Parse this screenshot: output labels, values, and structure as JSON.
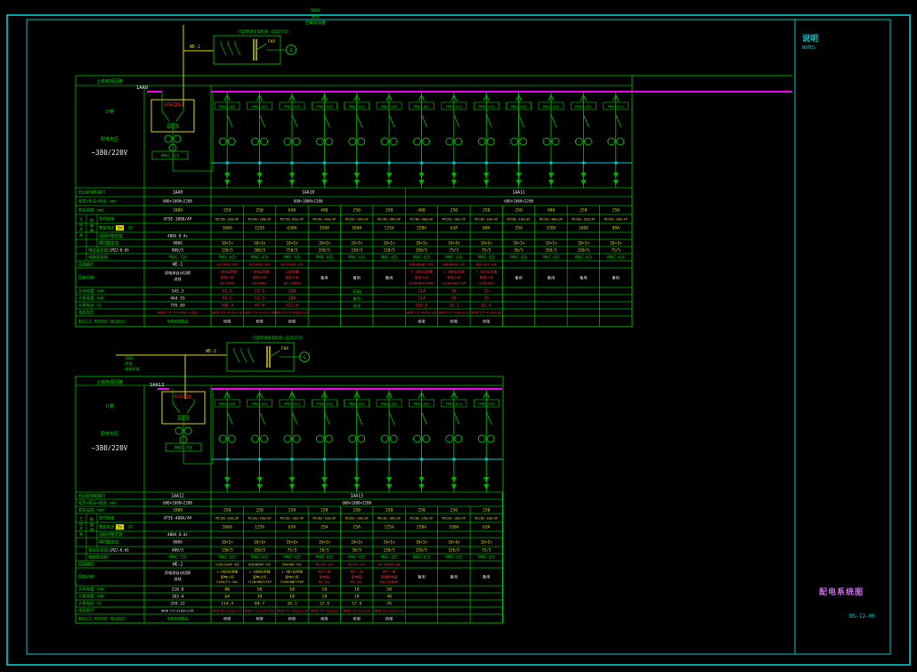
{
  "sheet": {
    "frame_color": "#00c8c8",
    "line_green": "#00b300",
    "text_green": "#00d000",
    "bus_magenta": "#f000f0",
    "yellow": "#d9d900",
    "red": "#ff3333",
    "white": "#ebebeb",
    "cyan": "#00c8c8",
    "title_magenta": "#cf6cf2",
    "notes": {
      "title": "说明",
      "subtitle": "NOTES"
    },
    "title_block": {
      "drawing_title": "配电系统图",
      "drawing_no": "DS-12-06"
    },
    "top_note": [
      "380V",
      "进线",
      "密集母线槽"
    ]
  },
  "table_labels": {
    "rows": [
      "低压配电柜编号",
      "柜宽×柜深×柜高（mm）",
      "安装高度（mm）",
      "型号规格",
      "整定电流",
      "短延时整定值",
      "瞬时整定值",
      "电流互感器",
      "电度表规格",
      "回路编号",
      "回路名称",
      "负荷容量（kW）",
      "计算容量（kW）",
      "计算电流（A）",
      "线缆型号",
      "敷设方式 电缆桥架（敷设部位）"
    ],
    "setting_hl": "In",
    "setting_post": "（A）",
    "ct_suffix": "LMZJ-0.66",
    "group_outer": "主进开关",
    "group_inner": "断路器"
  },
  "units": [
    {
      "header": "上级电源回路",
      "meter_room_label": "计量",
      "voltage_label": "配电电压",
      "voltage": "~380/220V",
      "bus_label": "1AA9",
      "incoming_id": "WE-1",
      "gen_note": "引自柴油发电机组（自动启动）",
      "gen_switch_label": "FKP",
      "gen_symbol": "G",
      "atse_red": "ATSE自投",
      "atse_green": "双电源",
      "sections": [
        {
          "name": "1AA9",
          "dims": "800×1000×2200",
          "span": 0
        },
        {
          "name": "1AA10",
          "dims": "600×1000×2200",
          "span": 6
        },
        {
          "name": "1AA11",
          "dims": "600×1000×2200",
          "span": 7
        }
      ],
      "incoming": {
        "height": "1800",
        "model": "ATSE-1000/4P",
        "delay": "400A 0.4s",
        "inst": "800A",
        "ct": "800/5",
        "meter": "PMAC-725",
        "id": "WE-1",
        "name": [
          "双电源自动切换",
          "进线"
        ],
        "load": "545.3",
        "calc": "464.55",
        "amps": "795.69",
        "cable": "WDZN-YJY-2(4×240+1×120)",
        "cablec": "r",
        "lay": "电缆桥架敷设"
      },
      "spare_note": [
        "380V",
        "备用",
        "出线"
      ],
      "feeders": [
        {
          "height": "250",
          "model": "MCCBS-160/3P",
          "setting": "160A",
          "inst": "10×In",
          "ct": "150/5",
          "meter": "PMAC-625",
          "id": "BV/1APE2-4ZE",
          "idc": "r",
          "name": [
            "一层A区商铺",
            "配电小间",
            "1N/1APE2"
          ],
          "nc": "r",
          "load": "55.5",
          "calc": "55.5",
          "amps": "105.4",
          "numc": "r",
          "cable": "WDZN-YJY-4×35+1×16",
          "lay": "桥架"
        },
        {
          "height": "250",
          "model": "MCCBS-160/3P",
          "setting": "125A",
          "inst": "10×In",
          "ct": "100/5",
          "meter": "PMAC-625",
          "id": "BV/2APE2-4ZE",
          "idc": "r",
          "name": [
            "一层B区商铺",
            "配电小间",
            "1N/2APE2"
          ],
          "nc": "r",
          "load": "51.5",
          "calc": "51.5",
          "amps": "97.8",
          "numc": "r",
          "cable": "WDZN-YJY-4×35+1×16",
          "lay": "桥架"
        },
        {
          "height": "630",
          "model": "MCCBS-630/3P",
          "setting": "630A",
          "inst": "10×In",
          "ct": "750/5",
          "meter": "PMAC-625",
          "id": "BV/1XHAPE-4ZE",
          "idc": "r",
          "name": [
            "二层商铺",
            "配电小间",
            "1N/1XHAPE"
          ],
          "nc": "r",
          "load": "280",
          "calc": "280",
          "amps": "531.8",
          "numc": "r",
          "cable": "WDZN-YJY-2(4×150+1×70)",
          "lay": "桥架"
        },
        {
          "height": "400",
          "model": "MCCBS-400/3P",
          "setting": "320A",
          "inst": "10×In",
          "ct": "350/5",
          "meter": "PMAC-625",
          "id": "",
          "name": [
            "备用"
          ],
          "nc": "w",
          "load": "",
          "calc": "",
          "amps": "",
          "numc": "w",
          "cable": "",
          "lay": ""
        },
        {
          "height": "250",
          "model": "MCCBS-160/3P",
          "setting": "160A",
          "inst": "10×In",
          "ct": "150/5",
          "meter": "PMAC-625",
          "id": "",
          "name": [
            "备用"
          ],
          "nc": "w",
          "load": "",
          "calc": "",
          "amps": "",
          "numc": "w",
          "cable": "",
          "lay": ""
        },
        {
          "height": "250",
          "model": "MCCBS-160/3P",
          "setting": "125A",
          "inst": "10×In",
          "ct": "150/5",
          "meter": "PMAC-625",
          "id": "",
          "name": [
            "备用"
          ],
          "nc": "w",
          "load": "",
          "calc": "",
          "amps": "",
          "numc": "w",
          "cable": "",
          "lay": ""
        },
        {
          "height": "400",
          "model": "MCCBS-400/3P",
          "setting": "320A",
          "inst": "10×In",
          "ct": "350/5",
          "meter": "PMAC-625",
          "id": "N2N/WDFWE2-4ZE",
          "idc": "r",
          "name": [
            "1-2层A区商铺",
            "配电小间",
            "S12W/WDFXTAP2"
          ],
          "nc": "r",
          "load": "114",
          "calc": "114",
          "amps": "216.5",
          "numc": "r",
          "cable": "WDZN-YJY-4×95+1×50",
          "lay": "桥架"
        },
        {
          "height": "250",
          "model": "MCCBS-100/3P",
          "setting": "63A",
          "inst": "10×In",
          "ct": "75/5",
          "meter": "PMAC-625",
          "id": "N2N/WDFWE-4ZE",
          "idc": "r",
          "name": [
            "1-2层B区商铺",
            "配电小间",
            "S12W/WDFXTAP"
          ],
          "nc": "r",
          "load": "18",
          "calc": "18",
          "amps": "39.1",
          "numc": "r",
          "cable": "WDZN-YJY-4×10+1×10",
          "lay": "桥架"
        },
        {
          "height": "250",
          "model": "MCCBS-100/3P",
          "setting": "80A",
          "inst": "10×In",
          "ct": "75/5",
          "meter": "PMAC-625",
          "id": "N2N/1ALE-4ZE",
          "idc": "r",
          "name": [
            "1-2层C区商铺",
            "配电小间",
            "S12W/1AL2"
          ],
          "nc": "r",
          "load": "35",
          "calc": "35",
          "amps": "62.6",
          "numc": "r",
          "cable": "WDZN-YJY-4×16+1×16",
          "lay": "桥架"
        },
        {
          "height": "250",
          "model": "MCCBS-100/3P",
          "setting": "25A",
          "inst": "10×In",
          "ct": "50/5",
          "meter": "PMAC-625",
          "id": "",
          "name": [
            "备用"
          ],
          "nc": "w",
          "load": "",
          "calc": "",
          "amps": "",
          "numc": "w",
          "cable": "",
          "lay": ""
        },
        {
          "height": "400",
          "model": "MCCBS-400/3P",
          "setting": "320A",
          "inst": "10×In",
          "ct": "350/5",
          "meter": "PMAC-625",
          "id": "",
          "name": [
            "备用"
          ],
          "nc": "w",
          "load": "",
          "calc": "",
          "amps": "",
          "numc": "w",
          "cable": "",
          "lay": ""
        },
        {
          "height": "250",
          "model": "MCCBS-160/3P",
          "setting": "160A",
          "inst": "10×In",
          "ct": "150/5",
          "meter": "PMAC-625",
          "id": "",
          "name": [
            "备用"
          ],
          "nc": "w",
          "load": "",
          "calc": "",
          "amps": "",
          "numc": "w",
          "cable": "",
          "lay": ""
        },
        {
          "height": "250",
          "model": "MCCBS-100/3P",
          "setting": "80A",
          "inst": "10×In",
          "ct": "75/5",
          "meter": "PMAC-625",
          "id": "",
          "name": [
            "备用"
          ],
          "nc": "w",
          "load": "",
          "calc": "",
          "amps": "",
          "numc": "w",
          "cable": "",
          "lay": ""
        }
      ]
    },
    {
      "header": "上级电源回路",
      "meter_room_label": "计量",
      "voltage_label": "配电电压",
      "voltage": "~380/220V",
      "bus_label": "1AA12",
      "incoming_id": "WE-2",
      "gen_note": "引自柴油发电机组（自动启动）",
      "gen_switch_label": "FKP",
      "gen_symbol": "G",
      "atse_red": "ATSE自投",
      "atse_green": "双电源",
      "incoming_note": [
        "380V",
        "进线",
        "电缆桥架"
      ],
      "sections": [
        {
          "name": "1AA12",
          "dims": "600×1000×2200",
          "span": 0
        },
        {
          "name": "1AA13",
          "dims": "600×1000×2200",
          "span": 9
        }
      ],
      "incoming": {
        "height": "1800",
        "model": "ATSE-400A/4P",
        "delay": "400A 0.4s",
        "inst": "800A",
        "ct": "400/5",
        "meter": "PMAC-725",
        "id": "WE-2",
        "name": [
          "双电源自动切换",
          "进线"
        ],
        "load": "218.8",
        "calc": "183.4",
        "amps": "259.22",
        "cable": "WDZN-YJY-4×185+1×95",
        "cablec": "w",
        "lay": "电缆桥架敷设"
      },
      "feeders": [
        {
          "height": "250",
          "model": "MCCBS-160/3P",
          "setting": "160A",
          "inst": "10×In",
          "ct": "150/5",
          "meter": "PMAC-625",
          "id": "S12W/1SHAP-4ZE",
          "idc": "y",
          "name": [
            "1-2层A区商铺",
            "配电小间",
            "S12W/F1-5AL"
          ],
          "nc": "y",
          "load": "80",
          "calc": "64",
          "amps": "114.4",
          "numc": "y",
          "cable": "WDZN-YJY-4×50+1×25",
          "lay": "桥架"
        },
        {
          "height": "250",
          "model": "MCCBS-160/3P",
          "setting": "125A",
          "inst": "10×In",
          "ct": "150/5",
          "meter": "PMAC-625",
          "id": "N2W/WDFWF-4ZE",
          "idc": "y",
          "name": [
            "1-2层B区商铺",
            "配电小间",
            "S12W/WDFXTAP"
          ],
          "nc": "y",
          "load": "50",
          "calc": "39",
          "amps": "84.7",
          "numc": "y",
          "cable": "WDZN-YJY-4×25+1×16",
          "lay": "桥架"
        },
        {
          "height": "250",
          "model": "MCCBS-100/3P",
          "setting": "63A",
          "inst": "10×In",
          "ct": "75/5",
          "meter": "PMAC-625",
          "id": "N2W/WDF-4ZE",
          "idc": "y",
          "name": [
            "1-2层C区商铺",
            "配电小间",
            "S12W/WDFXTAP"
          ],
          "nc": "y",
          "load": "18",
          "calc": "18",
          "amps": "39.1",
          "numc": "y",
          "cable": "WDZN-YJY-4×10+1×10",
          "lay": "桥架"
        },
        {
          "height": "250",
          "model": "MCCBS-100/3P",
          "setting": "25A",
          "inst": "10×In",
          "ct": "50/5",
          "meter": "PMAC-625",
          "id": "BV/4AL-4ZE",
          "idc": "r",
          "name": [
            "地下一层",
            "配电箱",
            "BV/4AL"
          ],
          "nc": "r",
          "load": "10",
          "calc": "10",
          "amps": "17.9",
          "numc": "y",
          "cable": "WDZN-YJY-4×6+1×6",
          "lay": "桥架"
        },
        {
          "height": "250",
          "model": "MCCBS-100/3P",
          "setting": "25A",
          "inst": "10×In",
          "ct": "50/5",
          "meter": "PMAC-625",
          "id": "BV/2AL-4ZE",
          "idc": "r",
          "name": [
            "地下一层",
            "配电箱",
            "BV/2AL"
          ],
          "nc": "r",
          "load": "10",
          "calc": "10",
          "amps": "17.9",
          "numc": "y",
          "cable": "WDZN-YJY-4×6+1×6",
          "lay": "桥架"
        },
        {
          "height": "250",
          "model": "MCCBS-160/3P",
          "setting": "125A",
          "inst": "10×In",
          "ct": "150/5",
          "meter": "PMAC-625",
          "id": "BV/1SHDAP-4ZE",
          "idc": "r",
          "name": [
            "地下一层",
            "商铺配电箱",
            "BV/1SHDAP"
          ],
          "nc": "r",
          "load": "50",
          "calc": "40",
          "amps": "76",
          "numc": "y",
          "cable": "WDZN-YJY-4×25+1×16",
          "lay": "桥架"
        },
        {
          "height": "250",
          "model": "MCCBS-250/3P",
          "setting": "250A",
          "inst": "10×In",
          "ct": "250/5",
          "meter": "PMAC-625",
          "id": "",
          "name": [
            "备用"
          ],
          "nc": "w",
          "load": "",
          "calc": "",
          "amps": "",
          "numc": "w",
          "cable": "",
          "lay": ""
        },
        {
          "height": "250",
          "model": "MCCBS-160/3P",
          "setting": "160A",
          "inst": "10×In",
          "ct": "150/5",
          "meter": "PMAC-625",
          "id": "",
          "name": [
            "备用"
          ],
          "nc": "w",
          "load": "",
          "calc": "",
          "amps": "",
          "numc": "w",
          "cable": "",
          "lay": ""
        },
        {
          "height": "250",
          "model": "MCCBS-100/3P",
          "setting": "63A",
          "inst": "10×In",
          "ct": "75/5",
          "meter": "PMAC-625",
          "id": "",
          "name": [
            "备用"
          ],
          "nc": "w",
          "load": "",
          "calc": "",
          "amps": "",
          "numc": "w",
          "cable": "",
          "lay": ""
        }
      ]
    }
  ]
}
